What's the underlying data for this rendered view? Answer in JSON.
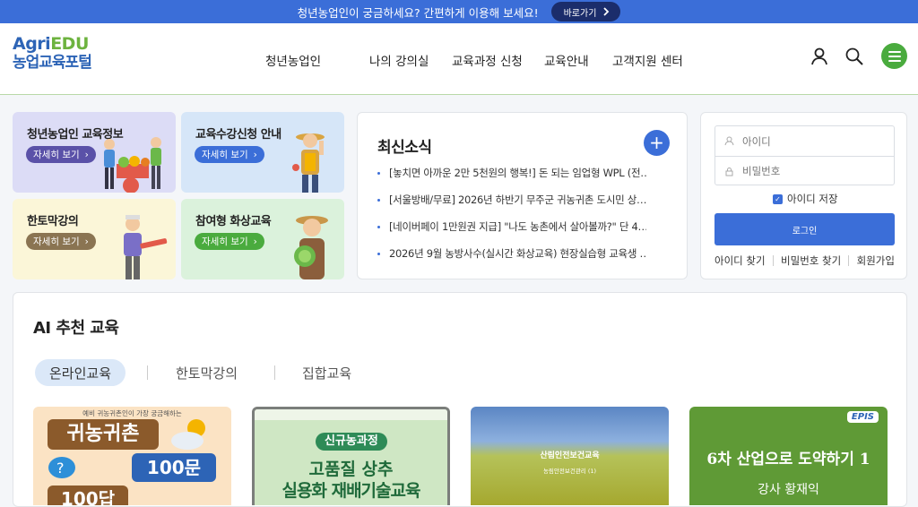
{
  "topbar": {
    "message": "청년농업인이 궁금하세요? 간편하게 이용해 보세요!",
    "go_label": "바로가기"
  },
  "header": {
    "logo_line1_a": "Agri",
    "logo_line1_b": "EDU",
    "logo_line2": "농업교육포털",
    "nav": [
      "청년농업인",
      "나의 강의실",
      "교육과정 신청",
      "교육안내",
      "고객지원 센터"
    ]
  },
  "quick_cards": [
    {
      "title": "청년농업인 교육정보",
      "button": "자세히 보기",
      "bg": "#dcdcf6",
      "btn": "#5a51a8"
    },
    {
      "title": "교육수강신청 안내",
      "button": "자세히 보기",
      "bg": "#d6e6f8",
      "btn": "#3b6ed8"
    },
    {
      "title": "한토막강의",
      "button": "자세히 보기",
      "bg": "#fbf6d8",
      "btn": "#8a7452"
    },
    {
      "title": "참여형 화상교육",
      "button": "자세히 보기",
      "bg": "#dbf2dc",
      "btn": "#4aab3e"
    }
  ],
  "news": {
    "title": "최신소식",
    "items": [
      "[놓치면 아까운 2만 5천원의 행복!] 돈 되는 임업형 WPL (전…",
      "[서울방배/무료] 2026년 하반기 무주군 귀농귀촌 도시민 상…",
      "[네이버페이 1만원권 지급] \"나도 농촌에서 살아볼까?\" 단 4…",
      "2026년 9월 농방사수(실시간 화상교육) 현장실습형 교육생 …"
    ]
  },
  "login": {
    "id_placeholder": "아이디",
    "pw_placeholder": "비밀번호",
    "save_label": "아이디 저장",
    "login_label": "로그인",
    "find_id": "아이디 찾기",
    "find_pw": "비밀번호 찾기",
    "signup": "회원가입"
  },
  "ai": {
    "title": "AI 추천 교육",
    "tabs": [
      "온라인교육",
      "한토막강의",
      "집합교육"
    ],
    "thumbs": [
      {
        "top_text": "예비 귀농귀촌인이 가장 궁금해하는",
        "big1": "귀농귀촌",
        "big2": "100문",
        "big3": "100답"
      },
      {
        "badge": "신규농과정",
        "line1": "고품질 상추",
        "line2": "실용화 재배기술교육"
      },
      {
        "line1": "산림인전보건교육",
        "line2": "농림안전보건관리 (1)"
      },
      {
        "logo": "EPIS",
        "line1": "6차 산업으로 도약하기 1",
        "line2": "강사 황재익"
      }
    ]
  },
  "colors": {
    "primary": "#3b6ed8",
    "green": "#4aab3e",
    "navy": "#1b2d6b"
  }
}
